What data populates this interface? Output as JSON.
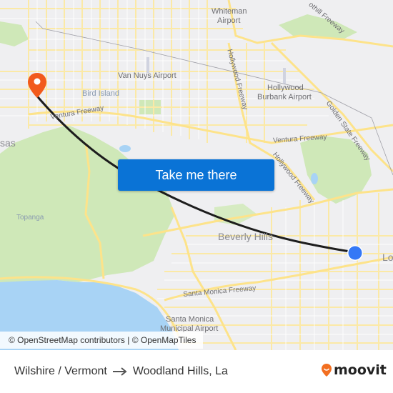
{
  "map": {
    "labels": {
      "whiteman_airport_1": "Whiteman",
      "whiteman_airport_2": "Airport",
      "foothill_freeway": "othill Freeway",
      "van_nuys_airport": "Van Nuys Airport",
      "bird_island": "Bird Island",
      "hollywood_freeway_north": "Hollywood Freeway",
      "burbank_airport_1": "Hollywood",
      "burbank_airport_2": "Burbank Airport",
      "golden_state_freeway": "Golden State Freeway",
      "ventura_freeway_west": "Ventura Freeway",
      "ventura_freeway_east": "Ventura Freeway",
      "hollywood_freeway_south": "Hollywood Freeway",
      "calabasas_partial": "sas",
      "topanga": "Topanga",
      "beverly_hills": "Beverly Hills",
      "los_angeles_partial": "Los",
      "santa_monica_freeway": "Santa Monica Freeway",
      "santa_monica_airport_1": "Santa Monica",
      "santa_monica_airport_2": "Municipal Airport"
    },
    "origin_marker_color": "#3478f6",
    "destination_marker_color": "#f25a1c",
    "route_line_color": "#1d1d1d"
  },
  "cta": {
    "label": "Take me there",
    "color": "#0a73d6"
  },
  "attribution": "© OpenStreetMap contributors | © OpenMapTiles",
  "footer": {
    "origin": "Wilshire / Vermont",
    "destination": "Woodland Hills, La",
    "brand": "moovit",
    "brand_color": "#f26f21"
  }
}
